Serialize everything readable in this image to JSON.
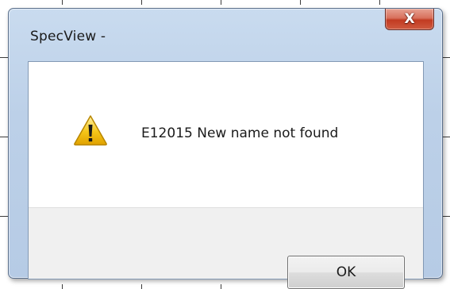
{
  "window": {
    "title": "SpecView -",
    "close_glyph": "X"
  },
  "message": {
    "icon": "warning-icon",
    "text": "E12015 New name not found"
  },
  "buttons": {
    "ok_label": "OK"
  },
  "colors": {
    "frame": "#bcd0e8",
    "close_button": "#c23b22",
    "warning_yellow": "#f5c518",
    "button_area": "#f0f0f0"
  }
}
